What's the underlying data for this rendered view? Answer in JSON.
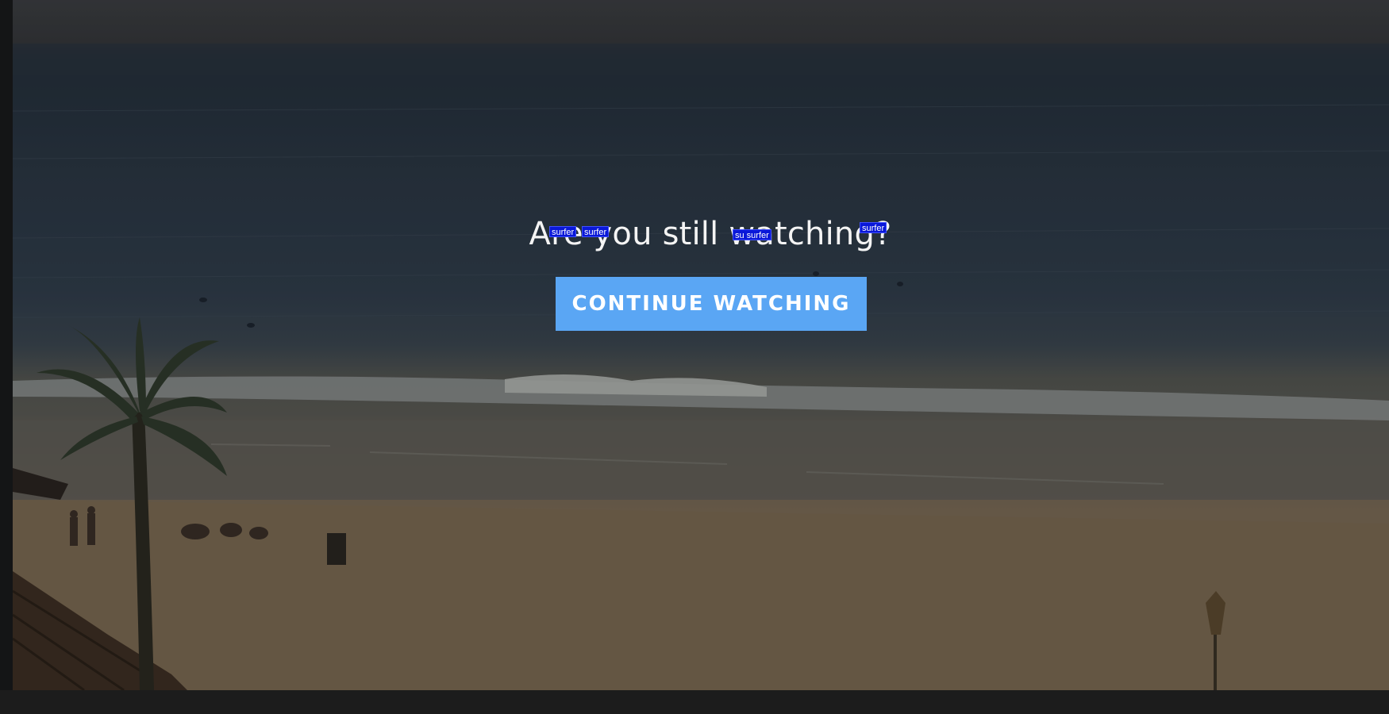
{
  "overlay": {
    "title": "Are you still watching?",
    "button_label": "CONTINUE WATCHING"
  },
  "detections": [
    {
      "label": "surfer"
    },
    {
      "label": "surfer"
    },
    {
      "label": "su surfer"
    },
    {
      "label": "surfer"
    }
  ],
  "colors": {
    "accent_button": "#5aa6f4",
    "detection_box": "#0a18d8",
    "title_text": "#f4f4f4",
    "background": "#1c1c1c"
  }
}
